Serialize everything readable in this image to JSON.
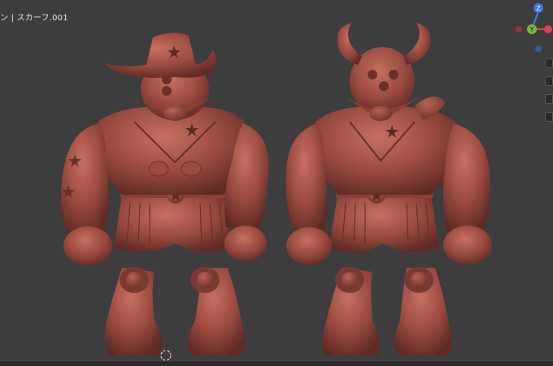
{
  "header": {
    "object_name": "ン | スカーフ.001"
  },
  "gizmo": {
    "axis_z_label": "Z",
    "axis_y_label": "Y",
    "axis_x_label": "X"
  },
  "colors": {
    "background": "#3d3d3d",
    "clay": "#9a4a40",
    "clay_dark": "#5e2a24",
    "clay_light": "#c06a5c",
    "axis_x": "#e0405a",
    "axis_y": "#78b83a",
    "axis_z": "#3a7be0"
  },
  "models": [
    {
      "name": "cowboy-hat-figure"
    },
    {
      "name": "horned-helmet-figure"
    }
  ]
}
